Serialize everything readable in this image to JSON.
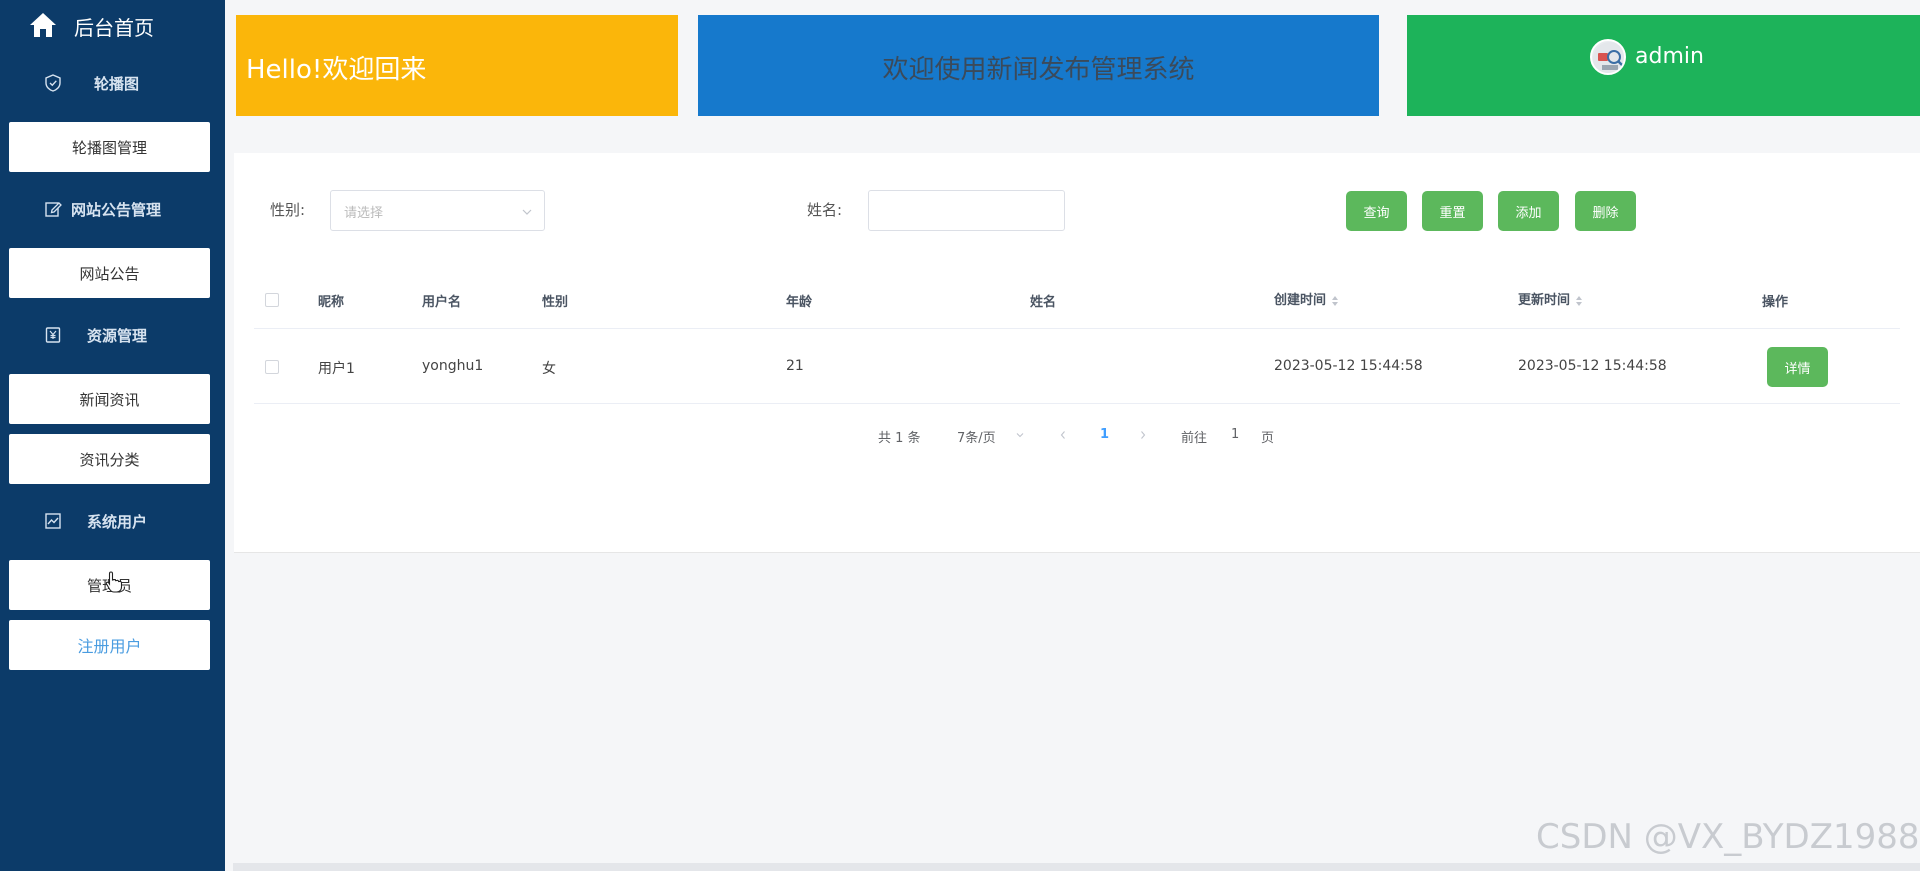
{
  "sidebar": {
    "home_label": "后台首页",
    "groups": [
      {
        "label": "轮播图",
        "icon": "shield-icon"
      },
      {
        "label": "网站公告管理",
        "icon": "edit-icon"
      },
      {
        "label": "资源管理",
        "icon": "money-icon"
      },
      {
        "label": "系统用户",
        "icon": "chart-icon"
      }
    ],
    "items": [
      {
        "label": "轮播图管理"
      },
      {
        "label": "网站公告"
      },
      {
        "label": "新闻资讯"
      },
      {
        "label": "资讯分类"
      },
      {
        "label": "管理员"
      },
      {
        "label": "注册用户",
        "active": true
      }
    ]
  },
  "header": {
    "welcome": "Hello!欢迎回来",
    "system_title": "欢迎使用新闻发布管理系统",
    "username": "admin"
  },
  "filters": {
    "gender_label": "性别:",
    "gender_placeholder": "请选择",
    "name_label": "姓名:",
    "name_value": ""
  },
  "buttons": {
    "query": "查询",
    "reset": "重置",
    "add": "添加",
    "delete": "删除"
  },
  "table": {
    "columns": [
      "昵称",
      "用户名",
      "性别",
      "年龄",
      "姓名",
      "创建时间",
      "更新时间",
      "操作"
    ],
    "rows": [
      {
        "nickname": "用户1",
        "username": "yonghu1",
        "gender": "女",
        "age": "21",
        "name": "",
        "created": "2023-05-12 15:44:58",
        "updated": "2023-05-12 15:44:58",
        "action": "详情"
      }
    ]
  },
  "pagination": {
    "total": "共 1 条",
    "page_size": "7条/页",
    "current_page": "1",
    "goto_prefix": "前往",
    "goto_value": "1",
    "goto_suffix": "页"
  },
  "watermark": "CSDN @VX_BYDZ1988",
  "colors": {
    "sidebar": "#0c3b69",
    "card_yellow": "#fbb60a",
    "card_blue": "#1679cc",
    "card_green": "#1db35a",
    "button_green": "#5cb85c",
    "active_link": "#4a9ce0"
  }
}
